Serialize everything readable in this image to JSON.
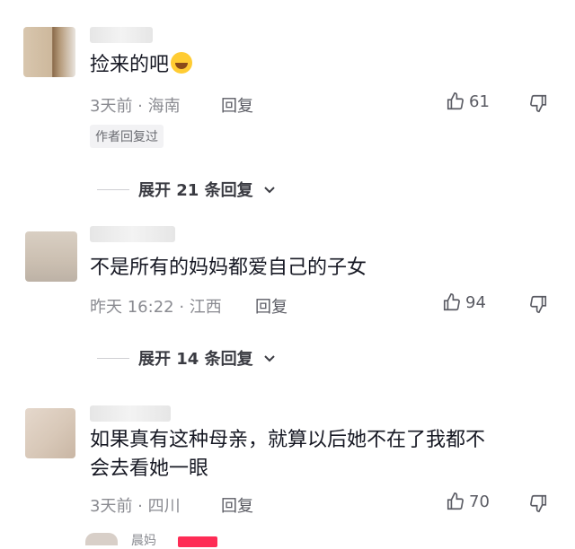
{
  "comments": [
    {
      "text": "捡来的吧",
      "emoji": "laughing-crying-emoji",
      "time_location": "3天前 · 海南",
      "reply_label": "回复",
      "likes": "61",
      "author_badge": "作者回复过",
      "expand_label": "展开 21 条回复"
    },
    {
      "text": "不是所有的妈妈都爱自己的子女",
      "time_location": "昨天 16:22 · 江西",
      "reply_label": "回复",
      "likes": "94",
      "expand_label": "展开 14 条回复"
    },
    {
      "text_line1": "如果真有这种母亲，就算以后她不在了我都不",
      "text_line2": "会去看她一眼",
      "time_location": "3天前 · 四川",
      "reply_label": "回复",
      "likes": "70"
    }
  ],
  "partial_next": {
    "name": "晨妈"
  },
  "colors": {
    "text": "#161823",
    "meta": "#8a8b91",
    "tag": "#fe2c55"
  }
}
